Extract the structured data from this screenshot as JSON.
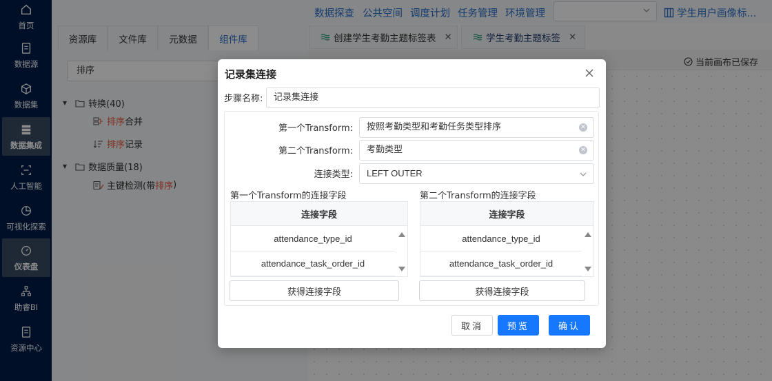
{
  "sidebar": {
    "items": [
      {
        "label": "首页",
        "icon": "home-icon"
      },
      {
        "label": "数据源",
        "icon": "database-icon"
      },
      {
        "label": "数据集",
        "icon": "cube-icon"
      },
      {
        "label": "数据集成",
        "icon": "integration-icon"
      },
      {
        "label": "人工智能",
        "icon": "ai-icon"
      },
      {
        "label": "可视化探索",
        "icon": "pie-chart-icon"
      },
      {
        "label": "仪表盘",
        "icon": "dashboard-icon"
      },
      {
        "label": "助睿BI",
        "icon": "org-chart-icon"
      },
      {
        "label": "资源中心",
        "icon": "resource-icon"
      }
    ]
  },
  "topnav": {
    "links": [
      "数据探查",
      "公共空间",
      "调度计划",
      "任务管理",
      "环境管理"
    ],
    "select_value": "",
    "user_title": "学生用户画像标..."
  },
  "left_panel": {
    "tabs": [
      "资源库",
      "文件库",
      "元数据",
      "组件库"
    ],
    "search_value": "排序",
    "tree": {
      "group1": "转换(40)",
      "item1_hl": "排序",
      "item1_rest": " 合并",
      "item2_hl": "排序",
      "item2_rest": " 记录",
      "group2": "数据质量(18)",
      "item3_pre": "主键检测(带 ",
      "item3_hl": "排序",
      "item3_post": " )"
    }
  },
  "editor": {
    "tabs": [
      "创建学生考勤主题标签表",
      "学生考勤主题标签"
    ],
    "saved_status": "当前画布已保存"
  },
  "modal": {
    "title": "记录集连接",
    "step_name_label": "步骤名称:",
    "step_name_value": "记录集连接",
    "first_transform_label": "第一个Transform:",
    "first_transform_value": "按照考勤类型和考勤任务类型排序",
    "second_transform_label": "第二个Transform:",
    "second_transform_value": "考勤类型",
    "join_type_label": "连接类型:",
    "join_type_value": "LEFT OUTER",
    "left_section_title": "第一个Transform的连接字段",
    "right_section_title": "第二个Transform的连接字段",
    "column_header": "连接字段",
    "left_fields": [
      "attendance_type_id",
      "attendance_task_order_id"
    ],
    "right_fields": [
      "attendance_type_id",
      "attendance_task_order_id"
    ],
    "get_fields_button": "获得连接字段",
    "cancel_button": "取消",
    "preview_button": "预览",
    "confirm_button": "确认"
  },
  "colors": {
    "sidebar_bg": "#001d4a",
    "accent": "#1677ff",
    "link": "#2a6fc9",
    "highlight": "#e8533b"
  }
}
